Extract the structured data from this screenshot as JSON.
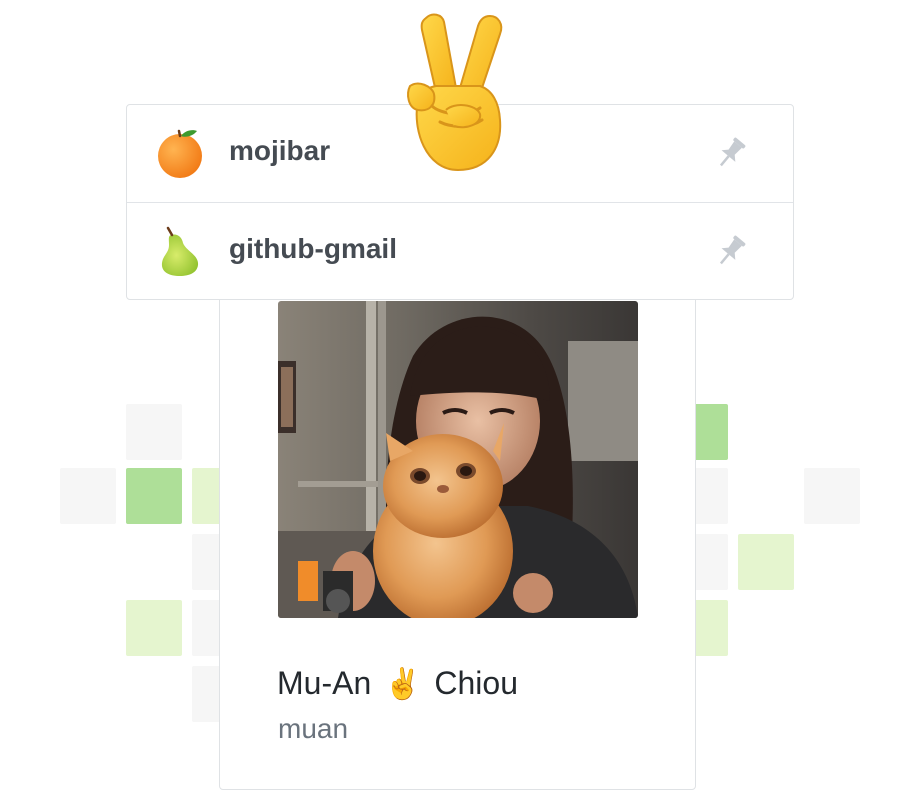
{
  "repos": [
    {
      "name": "mojibar",
      "icon": "orange-icon",
      "pinned": true
    },
    {
      "name": "github-gmail",
      "icon": "pear-icon",
      "pinned": true
    }
  ],
  "profile": {
    "first_name": "Mu-An",
    "emoji": "✌️",
    "last_name": "Chiou",
    "login": "muan"
  },
  "decorations": {
    "big_emoji": "victory-hand-icon"
  },
  "colors": {
    "contrib_level_0": "#f6f6f6",
    "contrib_level_1": "#e5f5cf",
    "contrib_level_2": "#aedf98",
    "text_primary": "#24292e",
    "text_muted": "#6a737d",
    "border": "#dfe2e5"
  }
}
